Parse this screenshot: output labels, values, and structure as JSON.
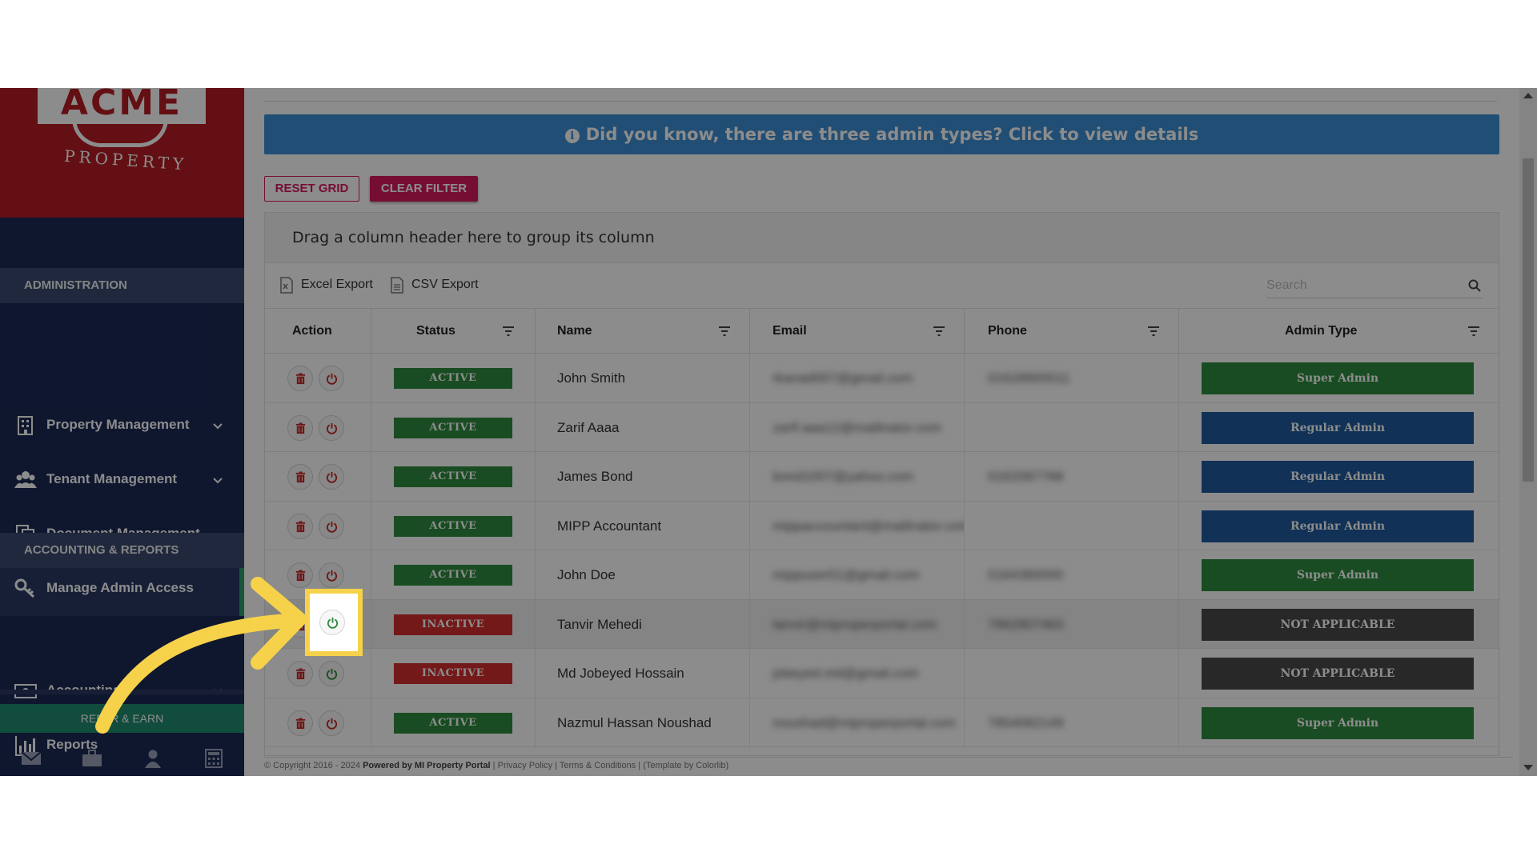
{
  "logo": {
    "brand": "ACME",
    "sub": "PROPERTY"
  },
  "sidebar": {
    "sections": [
      {
        "title": "ADMINISTRATION"
      },
      {
        "title": "ACCOUNTING & REPORTS"
      }
    ],
    "items": [
      {
        "label": "Property Management",
        "icon": "building-icon",
        "has_chevron": true
      },
      {
        "label": "Tenant Management",
        "icon": "users-icon",
        "has_chevron": true
      },
      {
        "label": "Document Management",
        "icon": "documents-icon",
        "has_chevron": false
      },
      {
        "label": "Manage Admin Access",
        "icon": "key-icon",
        "has_chevron": false,
        "active": true
      },
      {
        "label": "Accounting",
        "icon": "money-icon",
        "has_chevron": true
      },
      {
        "label": "Reports",
        "icon": "bar-chart-icon",
        "has_chevron": false
      }
    ],
    "refer_label": "REFER & EARN",
    "bottom_icons": [
      "mail-icon",
      "briefcase-icon",
      "user-icon",
      "calculator-icon"
    ]
  },
  "banner": {
    "text": "Did you know, there are three admin types? Click to view details"
  },
  "buttons": {
    "reset": "RESET GRID",
    "clear": "CLEAR FILTER"
  },
  "grid": {
    "group_panel": "Drag a column header here to group its column",
    "excel_export": "Excel Export",
    "csv_export": "CSV Export",
    "search_placeholder": "Search",
    "columns": {
      "action": "Action",
      "status": "Status",
      "name": "Name",
      "email": "Email",
      "phone": "Phone",
      "admin_type": "Admin Type"
    },
    "rows": [
      {
        "status": "ACTIVE",
        "name": "John Smith",
        "email": "rkanad007@gmail.com",
        "phone": "01628900011",
        "admin_type": "Super Admin"
      },
      {
        "status": "ACTIVE",
        "name": "Zarif Aaaa",
        "email": "zarif.aaa12@mailinator.com",
        "phone": "",
        "admin_type": "Regular Admin"
      },
      {
        "status": "ACTIVE",
        "name": "James Bond",
        "email": "bond1007@yahoo.com",
        "phone": "0162087788",
        "admin_type": "Regular Admin"
      },
      {
        "status": "ACTIVE",
        "name": "MIPP Accountant",
        "email": "mippaccountant@mailinator.com",
        "phone": "",
        "admin_type": "Regular Admin"
      },
      {
        "status": "ACTIVE",
        "name": "John Doe",
        "email": "mippuser01@gmail.com",
        "phone": "0164380000",
        "admin_type": "Super Admin"
      },
      {
        "status": "INACTIVE",
        "name": "Tanvir Mehedi",
        "email": "tanvir@miproperportal.com",
        "phone": "7862807483",
        "admin_type": "NOT APPLICABLE"
      },
      {
        "status": "INACTIVE",
        "name": "Md Jobeyed Hossain",
        "email": "jobeyed.md@gmail.com",
        "phone": "",
        "admin_type": "NOT APPLICABLE"
      },
      {
        "status": "ACTIVE",
        "name": "Nazmul Hassan Noushad",
        "email": "noushad@miproperportal.com",
        "phone": "7854082149",
        "admin_type": "Super Admin"
      }
    ]
  },
  "footer": {
    "copyright": "© Copyright 2016 - 2024",
    "powered": "Powered by MI Property Portal",
    "privacy": "Privacy Policy",
    "terms": "Terms & Conditions",
    "template": "(Template by Colorlib)"
  },
  "colors": {
    "sidebar": "#1c2a57",
    "logo_bg": "#b51d24",
    "banner": "#3c8fd4",
    "accent": "#d81b60",
    "active": "#2e8b3e",
    "inactive": "#d32f2f",
    "super_admin": "#2e8b3e",
    "regular_admin": "#1f5a9e",
    "not_applicable": "#4a4a4a",
    "highlight": "#f6d24a"
  }
}
